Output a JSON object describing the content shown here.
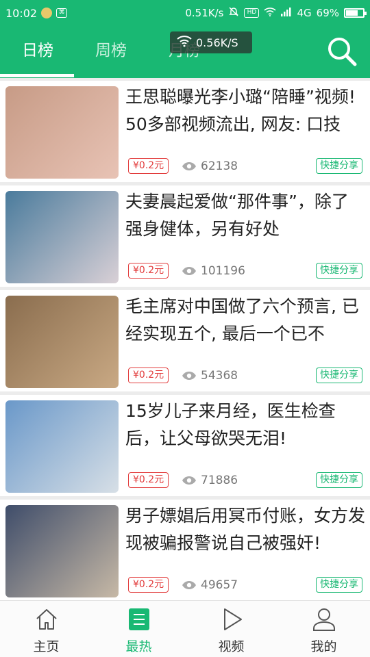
{
  "status_bar": {
    "time": "10:02",
    "net_speed": "0.51K/s",
    "hd": "HD",
    "network": "4G",
    "battery": "69%",
    "battery_level": 0.69
  },
  "tabs": [
    {
      "label": "日榜",
      "active": true
    },
    {
      "label": "周榜",
      "active": false
    },
    {
      "label": "月榜",
      "active": false
    }
  ],
  "speed_overlay": "0.56K/S",
  "articles": [
    {
      "title": "王思聪曝光李小璐“陪睡”视频! 50多部视频流出, 网友: 口技",
      "price": "¥0.2元",
      "views": "62138",
      "share": "快捷分享",
      "thumb_colors": [
        "#c79b86",
        "#e8c3b5"
      ]
    },
    {
      "title": "夫妻晨起爱做“那件事”，除了强身健体，另有好处",
      "price": "¥0.2元",
      "views": "101196",
      "share": "快捷分享",
      "thumb_colors": [
        "#4a7b9c",
        "#d9d0d6"
      ]
    },
    {
      "title": "毛主席对中国做了六个预言, 已经实现五个, 最后一个已不",
      "price": "¥0.2元",
      "views": "54368",
      "share": "快捷分享",
      "thumb_colors": [
        "#8a6d4e",
        "#c9a984"
      ]
    },
    {
      "title": "15岁儿子来月经，医生检查后，让父母欲哭无泪!",
      "price": "¥0.2元",
      "views": "71886",
      "share": "快捷分享",
      "thumb_colors": [
        "#6a98c9",
        "#d7dfe6"
      ]
    },
    {
      "title": "男子嫖娼后用冥币付账，女方发现被骗报警说自己被强奸!",
      "price": "¥0.2元",
      "views": "49657",
      "share": "快捷分享",
      "thumb_colors": [
        "#3f4d6a",
        "#c7b9a6"
      ]
    }
  ],
  "bottom_nav": [
    {
      "label": "主页",
      "icon": "home-icon",
      "active": false
    },
    {
      "label": "最热",
      "icon": "hot-list-icon",
      "active": true
    },
    {
      "label": "视频",
      "icon": "play-icon",
      "active": false
    },
    {
      "label": "我的",
      "icon": "user-icon",
      "active": false
    }
  ],
  "colors": {
    "brand_green": "#19b873",
    "price_red": "#e23b3b"
  }
}
